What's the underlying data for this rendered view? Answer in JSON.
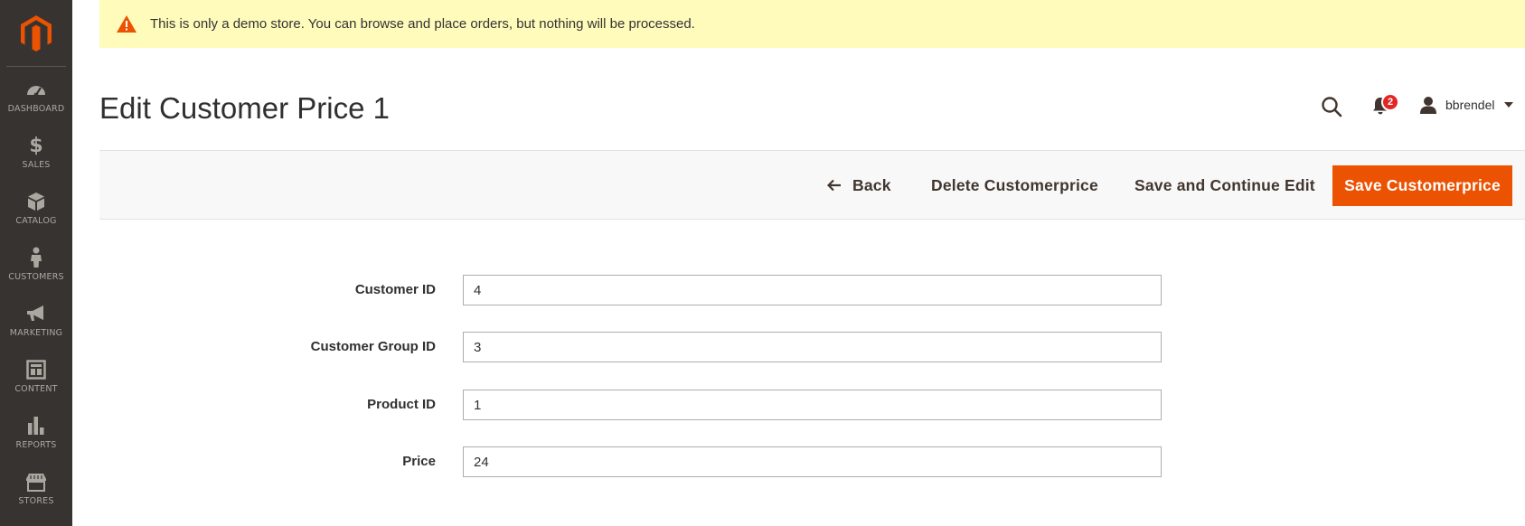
{
  "notice": {
    "text": "This is only a demo store. You can browse and place orders, but nothing will be processed."
  },
  "sidebar": {
    "items": [
      {
        "label": "DASHBOARD",
        "icon": "dashboard-icon"
      },
      {
        "label": "SALES",
        "icon": "dollar-icon"
      },
      {
        "label": "CATALOG",
        "icon": "box-icon"
      },
      {
        "label": "CUSTOMERS",
        "icon": "person-icon"
      },
      {
        "label": "MARKETING",
        "icon": "megaphone-icon"
      },
      {
        "label": "CONTENT",
        "icon": "layout-icon"
      },
      {
        "label": "REPORTS",
        "icon": "bar-chart-icon"
      },
      {
        "label": "STORES",
        "icon": "storefront-icon"
      }
    ]
  },
  "header": {
    "title": "Edit Customer Price 1",
    "notifications_count": "2",
    "user_name": "bbrendel"
  },
  "actions": {
    "back_label": "Back",
    "delete_label": "Delete Customerprice",
    "save_continue_label": "Save and Continue Edit",
    "save_label": "Save Customerprice"
  },
  "form": {
    "fields": [
      {
        "label": "Customer ID",
        "value": "4"
      },
      {
        "label": "Customer Group ID",
        "value": "3"
      },
      {
        "label": "Product ID",
        "value": "1"
      },
      {
        "label": "Price",
        "value": "24"
      }
    ]
  },
  "colors": {
    "sidebar_bg": "#373330",
    "accent": "#eb5202",
    "notice_bg": "#fffbbb",
    "badge": "#e22626"
  }
}
